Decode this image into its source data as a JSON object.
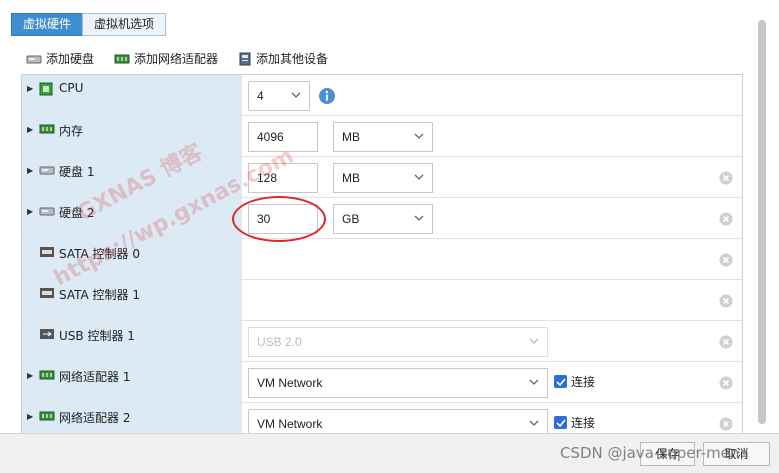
{
  "tabs": [
    {
      "label": "虚拟硬件",
      "active": true
    },
    {
      "label": "虚拟机选项",
      "active": false
    }
  ],
  "toolbar": {
    "add_disk": "添加硬盘",
    "add_network": "添加网络适配器",
    "add_other": "添加其他设备"
  },
  "devices": {
    "cpu": {
      "label": "CPU",
      "value": "4"
    },
    "memory": {
      "label": "内存",
      "value": "4096",
      "unit": "MB"
    },
    "disk1": {
      "label": "硬盘 1",
      "value": "128",
      "unit": "MB"
    },
    "disk2": {
      "label": "硬盘 2",
      "value": "30",
      "unit": "GB"
    },
    "sata0": {
      "label": "SATA 控制器 0"
    },
    "sata1": {
      "label": "SATA 控制器 1"
    },
    "usb1": {
      "label": "USB 控制器 1",
      "value": "USB 2.0"
    },
    "net1": {
      "label": "网络适配器 1",
      "value": "VM Network",
      "connect_label": "连接"
    },
    "net2": {
      "label": "网络适配器 2",
      "value": "VM Network",
      "connect_label": "连接"
    }
  },
  "footer": {
    "save_label": "保存",
    "cancel_label": "取消"
  },
  "watermarks": {
    "line1": "GXNAS 博客",
    "line2": "https://wp.gxnas.com",
    "csdn": "CSDN @java-super-men"
  },
  "colors": {
    "accent": "#3e8ed0",
    "row_left_bg": "#dbeaf5",
    "annotation": "#e0262a",
    "checkbox": "#2a6fd6"
  }
}
